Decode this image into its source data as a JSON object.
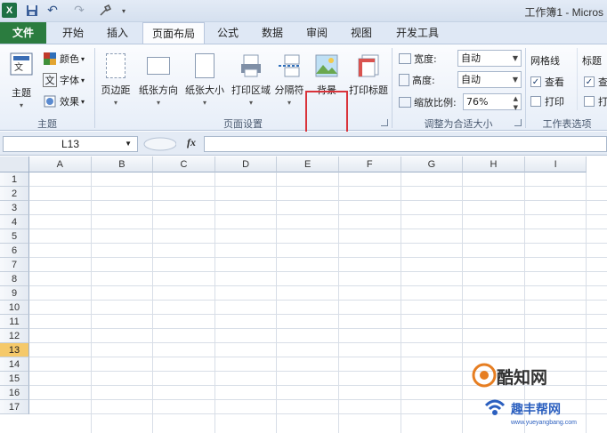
{
  "titlebar": {
    "app_logo": "X",
    "undo_icon": "↶",
    "redo_icon": "↷",
    "title": "工作簿1 - Micros"
  },
  "tabs": [
    {
      "label": "文件"
    },
    {
      "label": "开始"
    },
    {
      "label": "插入"
    },
    {
      "label": "页面布局"
    },
    {
      "label": "公式"
    },
    {
      "label": "数据"
    },
    {
      "label": "审阅"
    },
    {
      "label": "视图"
    },
    {
      "label": "开发工具"
    }
  ],
  "ribbon": {
    "themes": {
      "theme_label": "主题",
      "colors_label": "颜色",
      "fonts_label": "字体",
      "effects_label": "效果",
      "group_label": "主题"
    },
    "page_setup": {
      "buttons": [
        {
          "label": "页边距"
        },
        {
          "label": "纸张方向"
        },
        {
          "label": "纸张大小"
        },
        {
          "label": "打印区域"
        },
        {
          "label": "分隔符"
        },
        {
          "label": "背景"
        },
        {
          "label": "打印标题"
        }
      ],
      "group_label": "页面设置"
    },
    "scale": {
      "width_label": "宽度:",
      "width_value": "自动",
      "height_label": "高度:",
      "height_value": "自动",
      "scale_label": "缩放比例:",
      "scale_value": "76%",
      "group_label": "调整为合适大小"
    },
    "sheet_options": {
      "gridlines_title": "网格线",
      "gridlines_view_label": "查看",
      "gridlines_view_checked": true,
      "gridlines_print_label": "打印",
      "gridlines_print_checked": false,
      "headings_title": "标题",
      "headings_view_label": "查",
      "headings_view_checked": true,
      "headings_print_label": "打",
      "headings_print_checked": false,
      "group_label": "工作表选项"
    }
  },
  "formula_bar": {
    "name_box": "L13",
    "fx_label": "fx",
    "formula": ""
  },
  "grid": {
    "columns": [
      "A",
      "B",
      "C",
      "D",
      "E",
      "F",
      "G",
      "H",
      "I"
    ],
    "rows": [
      "1",
      "2",
      "3",
      "4",
      "5",
      "6",
      "7",
      "8",
      "9",
      "10",
      "11",
      "12",
      "13",
      "14",
      "15",
      "16",
      "17"
    ],
    "selected_row": "13",
    "selected_row_color": "#f5c96a"
  },
  "watermark": {
    "text": "酷知网",
    "sub": "趣丰帮网",
    "url": "www.yueyangbang.com"
  }
}
